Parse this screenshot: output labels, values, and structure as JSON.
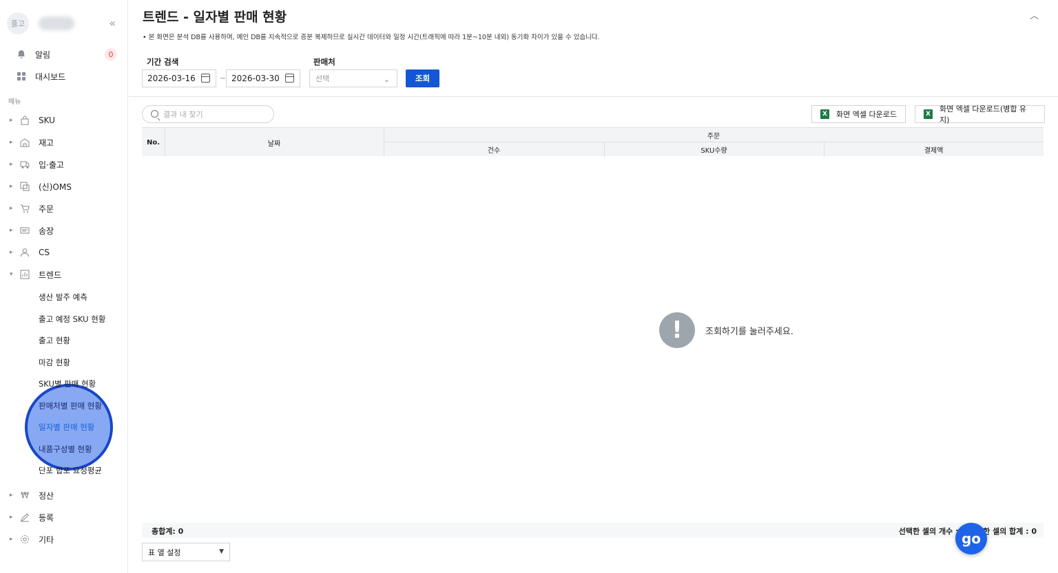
{
  "sidebar": {
    "avatar_text": "풀고",
    "collapse_icon": "«",
    "top_items": [
      {
        "label": "알림",
        "icon": "bell-icon",
        "badge": "0"
      },
      {
        "label": "대시보드",
        "icon": "dashboard-icon"
      }
    ],
    "section_label": "메뉴",
    "menu": [
      {
        "label": "SKU",
        "icon": "bag-icon"
      },
      {
        "label": "재고",
        "icon": "warehouse-icon"
      },
      {
        "label": "입·출고",
        "icon": "truck-icon"
      },
      {
        "label": "(신)OMS",
        "icon": "oms-icon"
      },
      {
        "label": "주문",
        "icon": "cart-icon"
      },
      {
        "label": "송장",
        "icon": "invoice-icon"
      },
      {
        "label": "CS",
        "icon": "person-icon"
      },
      {
        "label": "트렌드",
        "icon": "chart-icon",
        "expanded": true
      }
    ],
    "trend_sub": [
      "생산 발주 예측",
      "출고 예정 SKU 현황",
      "출고 현황",
      "마감 현황",
      "SKU별 판매 현황",
      "판매처별 판매 현황",
      "일자별 판매 현황",
      "내품구성별 현황",
      "단포 합포 요청평균"
    ],
    "active_sub": "일자별 판매 현황",
    "bottom_menu": [
      {
        "label": "정산",
        "icon": "won-icon"
      },
      {
        "label": "등록",
        "icon": "pencil-icon"
      },
      {
        "label": "기타",
        "icon": "gear-icon"
      }
    ]
  },
  "header": {
    "title": "트렌드 - 일자별 판매 현황",
    "notice": "• 본 화면은 분석 DB를 사용하며, 메인 DB를 지속적으로 증분 복제하므로 실시간 데이터와 일정 시간(트래픽에 따라 1분~10분 내외) 동기화 차이가 있을 수 있습니다."
  },
  "filters": {
    "period_label": "기간 검색",
    "start_date": "2026-03-16",
    "separator": "~",
    "end_date": "2026-03-30",
    "seller_label": "판매처",
    "seller_placeholder": "선택",
    "search_button": "조회"
  },
  "toolbar": {
    "search_placeholder": "결과 내 찾기",
    "excel_download": "화면 엑셀 다운로드",
    "excel_download_merge": "화면 엑셀 다운로드(병합 유지)"
  },
  "table": {
    "col_no": "No.",
    "col_date": "날짜",
    "group_order": "주문",
    "sub_columns": [
      "건수",
      "SKU수량",
      "결제액"
    ]
  },
  "empty_state": {
    "icon_glyph": "!",
    "message": "조회하기를 눌러주세요."
  },
  "footer": {
    "total": "총합계: 0",
    "selection": "선택한 셀의 개수 : 0  선택한 셀의 합계 : 0",
    "column_settings": "표 열 설정"
  },
  "chat_widget": {
    "label": "go"
  }
}
